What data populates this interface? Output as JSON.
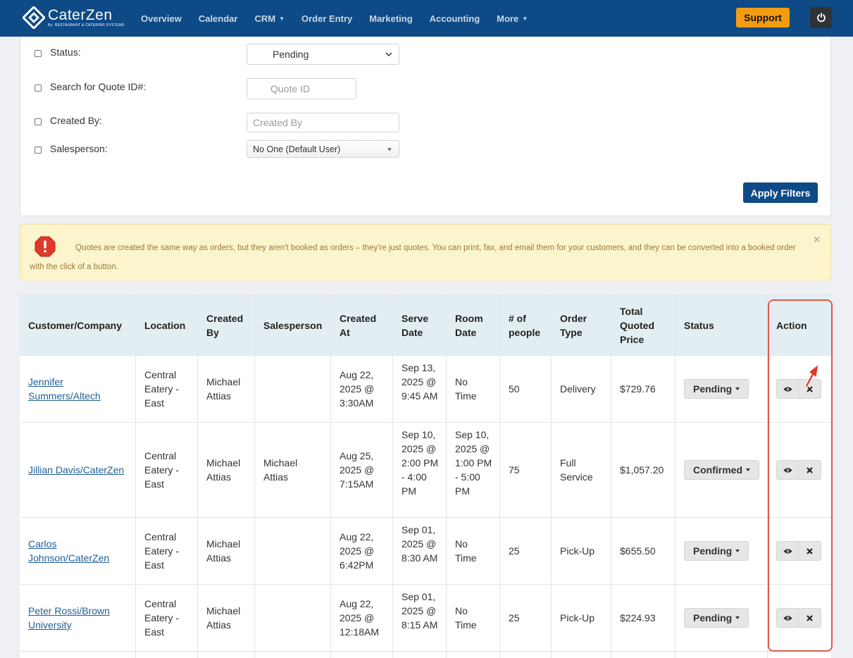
{
  "nav": {
    "brand": "CaterZen",
    "brand_sub": "By: RESTAURANT & CATERING SYSTEMS",
    "items": [
      {
        "label": "Overview",
        "dropdown": false
      },
      {
        "label": "Calendar",
        "dropdown": false
      },
      {
        "label": "CRM",
        "dropdown": true
      },
      {
        "label": "Order Entry",
        "dropdown": false
      },
      {
        "label": "Marketing",
        "dropdown": false
      },
      {
        "label": "Accounting",
        "dropdown": false
      },
      {
        "label": "More",
        "dropdown": true
      }
    ],
    "support_label": "Support",
    "colors": {
      "bar": "#0e4a85",
      "support": "#f39c12"
    }
  },
  "filters": {
    "status_label": "Status:",
    "status_value": "Pending",
    "quote_id_label": "Search for Quote ID#:",
    "quote_id_placeholder": "Quote ID",
    "created_by_label": "Created By:",
    "created_by_placeholder": "Created By",
    "salesperson_label": "Salesperson:",
    "salesperson_value": "No One (Default User)",
    "apply_label": "Apply Filters"
  },
  "alert": {
    "text": "Quotes are created the same way as orders, but they aren't booked as orders – they're just quotes. You can print, fax, and email them for your customers, and they can be converted into a booked order with the click of a button.",
    "close": "×"
  },
  "table": {
    "headers": [
      "Customer/Company",
      "Location",
      "Created By",
      "Salesperson",
      "Created At",
      "Serve Date",
      "Room Date",
      "# of people",
      "Order Type",
      "Total Quoted Price",
      "Status",
      "Action"
    ],
    "rows": [
      {
        "customer": "Jennifer Summers/Altech",
        "location": "Central Eatery - East",
        "created_by": "Michael Attias",
        "salesperson": "",
        "created_at": "Aug 22, 2025 @ 3:30AM",
        "serve_date": "Sep 13, 2025 @ 9:45 AM",
        "room_date": "No Time",
        "people": "50",
        "order_type": "Delivery",
        "price": "$729.76",
        "status": "Pending"
      },
      {
        "customer": "Jillian Davis/CaterZen",
        "location": "Central Eatery - East",
        "created_by": "Michael Attias",
        "salesperson": "Michael Attias",
        "created_at": "Aug 25, 2025 @ 7:15AM",
        "serve_date": "Sep 10, 2025 @ 2:00 PM - 4:00 PM",
        "room_date": "Sep 10, 2025 @ 1:00 PM - 5:00 PM",
        "people": "75",
        "order_type": "Full Service",
        "price": "$1,057.20",
        "status": "Confirmed"
      },
      {
        "customer": "Carlos Johnson/CaterZen",
        "location": "Central Eatery - East",
        "created_by": "Michael Attias",
        "salesperson": "",
        "created_at": "Aug 22, 2025 @ 6:42PM",
        "serve_date": "Sep 01, 2025 @ 8:30 AM",
        "room_date": "No Time",
        "people": "25",
        "order_type": "Pick-Up",
        "price": "$655.50",
        "status": "Pending"
      },
      {
        "customer": "Peter Rossi/Brown University",
        "location": "Central Eatery - East",
        "created_by": "Michael Attias",
        "salesperson": "",
        "created_at": "Aug 22, 2025 @ 12:18AM",
        "serve_date": "Sep 01, 2025 @ 8:15 AM",
        "room_date": "No Time",
        "people": "25",
        "order_type": "Pick-Up",
        "price": "$224.93",
        "status": "Pending"
      }
    ],
    "actions": {
      "view_icon": "eye-icon",
      "delete_icon": "close-icon"
    },
    "highlight_color": "#e05a4a"
  }
}
